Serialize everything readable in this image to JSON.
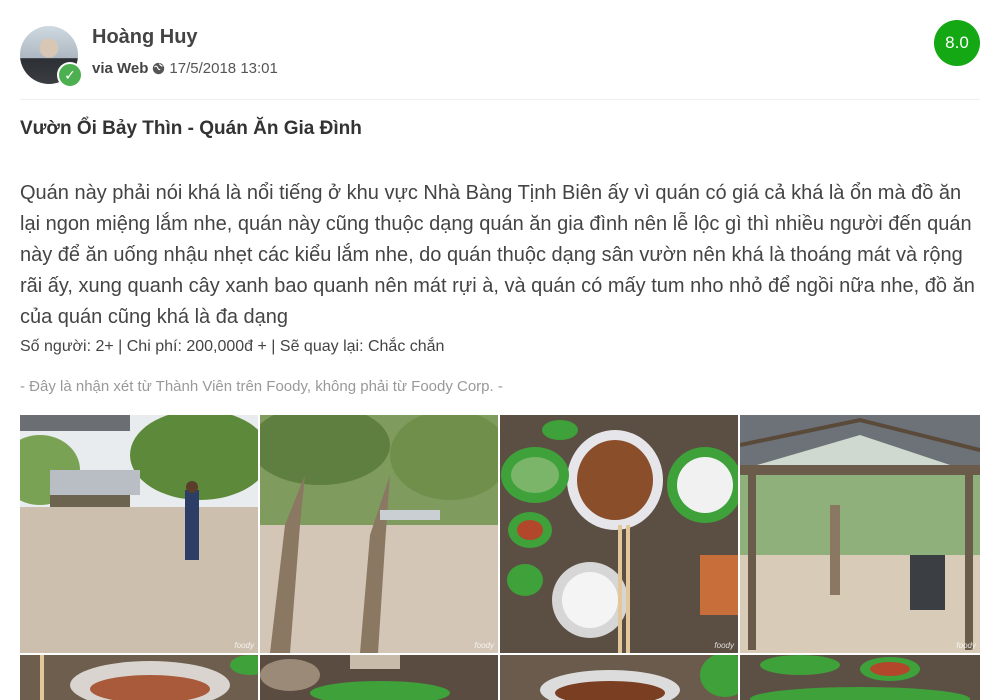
{
  "review": {
    "username": "Hoàng Huy",
    "via": "via Web",
    "timestamp": "17/5/2018 13:01",
    "score": "8.0",
    "title": "Vườn Ổi Bảy Thìn - Quán Ăn Gia Đình",
    "body": "Quán này phải nói khá là nổi tiếng ở khu vực Nhà Bàng Tịnh Biên ấy vì quán có giá cả khá là ổn mà đồ ăn lại ngon miệng lắm nhe, quán này cũng thuộc dạng quán ăn gia đình nên lễ lộc gì thì nhiều người đến quán này để ăn uống nhậu nhẹt các kiểu lắm nhe, do quán thuộc dạng sân vườn nên khá là thoáng mát và rộng rãi ấy, xung quanh cây xanh bao quanh nên mát rựi à, và quán có mấy tum nho nhỏ để ngồi nữa nhe, đồ ăn của quán cũng khá là đa dạng",
    "stats": "Số người: 2+ | Chi phí: 200,000đ + | Sẽ quay lại: Chắc chắn",
    "disclaimer": "- Đây là nhận xét từ Thành Viên trên Foody, không phải từ Foody Corp. -"
  },
  "icons": {
    "verified": "check-icon",
    "globe": "globe-icon"
  },
  "colors": {
    "score_badge": "#14a814",
    "verified_badge": "#4caf50",
    "disclaimer_text": "#999999"
  },
  "photos": [
    {
      "watermark": "foody"
    },
    {
      "watermark": "foody"
    },
    {
      "watermark": "foody"
    },
    {
      "watermark": "foody"
    },
    {
      "watermark": ""
    },
    {
      "watermark": ""
    },
    {
      "watermark": ""
    },
    {
      "watermark": ""
    }
  ]
}
